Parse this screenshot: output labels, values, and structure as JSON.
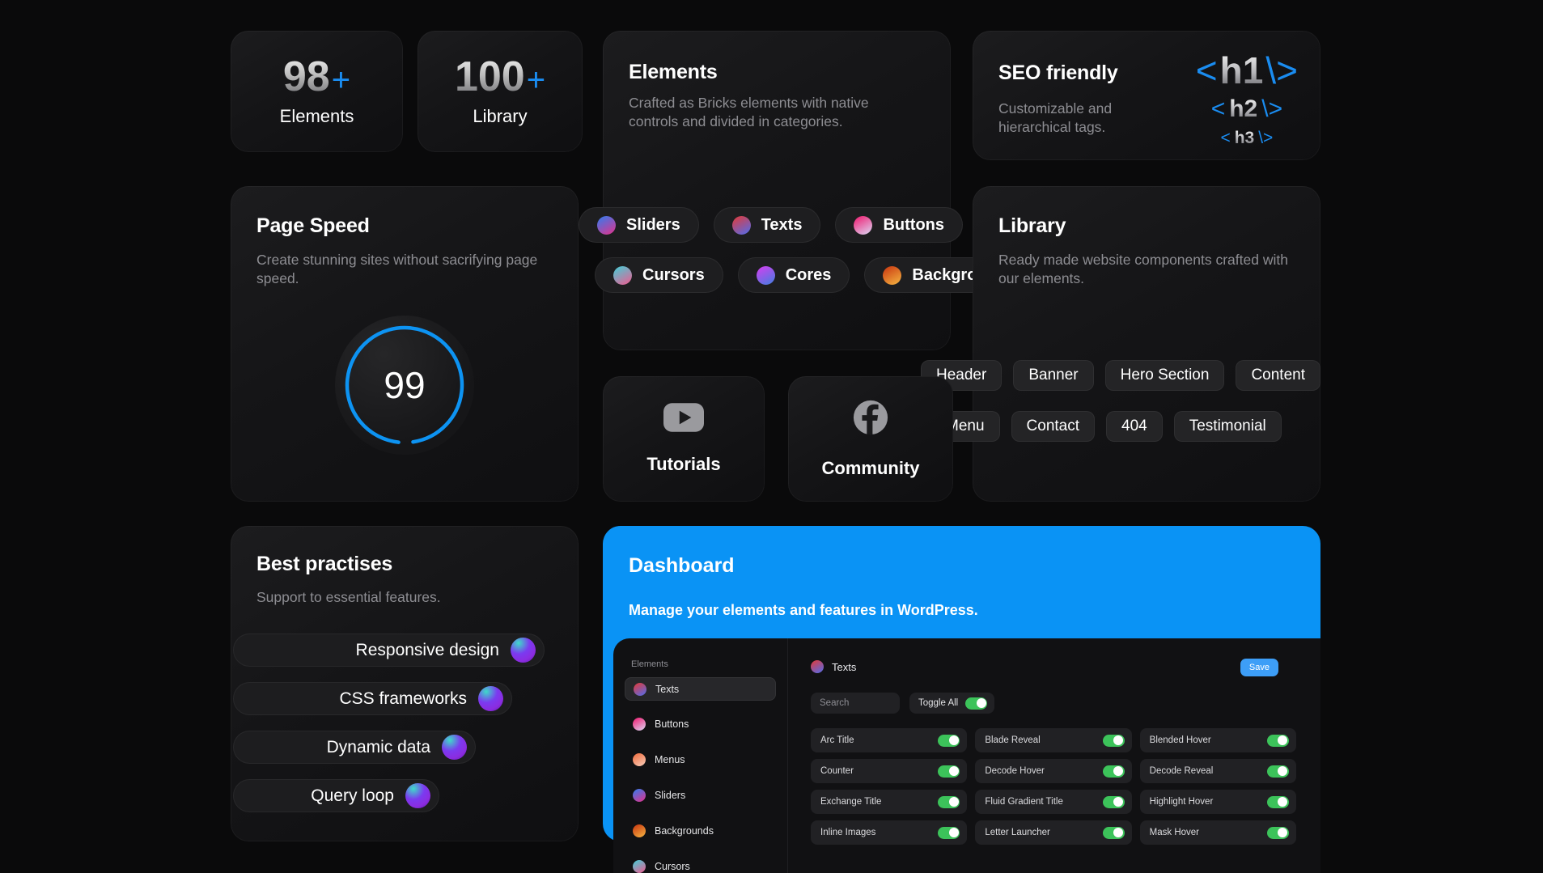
{
  "stats": [
    {
      "number": "98",
      "plus": "+",
      "label": "Elements"
    },
    {
      "number": "100",
      "plus": "+",
      "label": "Library"
    }
  ],
  "elements_card": {
    "title": "Elements",
    "subtitle": "Crafted as Bricks elements with native controls and divided in categories.",
    "pills_row1": [
      {
        "label": "Sliders",
        "color_a": "#2f7df0",
        "color_b": "#e5318a"
      },
      {
        "label": "Texts",
        "color_a": "#e53935",
        "color_b": "#4f6df0"
      },
      {
        "label": "Buttons",
        "color_a": "#f0176e",
        "color_b": "#dcd8f5"
      }
    ],
    "pills_row2": [
      {
        "label": "Cursors",
        "color_a": "#3fd0d8",
        "color_b": "#f25a8f"
      },
      {
        "label": "Cores",
        "color_a": "#d83df0",
        "color_b": "#3f7fe0"
      },
      {
        "label": "Backgrounds",
        "color_a": "#c8340f",
        "color_b": "#f5b642"
      }
    ]
  },
  "seo_card": {
    "title": "SEO friendly",
    "subtitle": "Customizable and hierarchical tags.",
    "h1_open": "<",
    "h1_tag": "h1",
    "h1_close": "\\>",
    "h2_open": "<",
    "h2_tag": "h2",
    "h2_close": "\\>",
    "h3_open": "<",
    "h3_tag": "h3",
    "h3_close": "\\>"
  },
  "page_speed_card": {
    "title": "Page Speed",
    "subtitle": "Create stunning sites without sacrifying page speed.",
    "score": "99",
    "ring_color": "#0d93f2"
  },
  "library_card": {
    "title": "Library",
    "subtitle": "Ready made website components crafted with our elements.",
    "tags_row1": [
      "Header",
      "Banner",
      "Hero Section",
      "Content"
    ],
    "tags_row2": [
      "Menu",
      "Contact",
      "404",
      "Testimonial"
    ]
  },
  "social_cards": [
    {
      "label": "Tutorials",
      "icon": "youtube-icon"
    },
    {
      "label": "Community",
      "icon": "facebook-icon"
    }
  ],
  "best_practises_card": {
    "title": "Best practises",
    "subtitle": "Support to essential features.",
    "rows": [
      "Responsive design",
      "CSS frameworks",
      "Dynamic data",
      "Query loop"
    ]
  },
  "dashboard_card": {
    "title": "Dashboard",
    "subtitle": "Manage your elements and features in WordPress.",
    "accent_color": "#0a93f5",
    "panel": {
      "sidebar_header": "Elements",
      "sidebar_items": [
        {
          "label": "Texts",
          "active": true,
          "color_a": "#e53935",
          "color_b": "#4f6df0"
        },
        {
          "label": "Buttons",
          "active": false,
          "color_a": "#f0176e",
          "color_b": "#dcd8f5"
        },
        {
          "label": "Menus",
          "active": false,
          "color_a": "#f06a3a",
          "color_b": "#f7cdbb"
        },
        {
          "label": "Sliders",
          "active": false,
          "color_a": "#2f7df0",
          "color_b": "#e5318a"
        },
        {
          "label": "Backgrounds",
          "active": false,
          "color_a": "#c8340f",
          "color_b": "#f5b642"
        },
        {
          "label": "Cursors",
          "active": false,
          "color_a": "#3fd0d8",
          "color_b": "#f25a8f"
        }
      ],
      "header_label": "Texts",
      "header_color_a": "#e53935",
      "header_color_b": "#4f6df0",
      "save_label": "Save",
      "search_placeholder": "Search",
      "toggle_all_label": "Toggle All",
      "toggle_all_on": true,
      "toggles": [
        {
          "label": "Arc Title",
          "on": true
        },
        {
          "label": "Blade Reveal",
          "on": true
        },
        {
          "label": "Blended Hover",
          "on": true
        },
        {
          "label": "Counter",
          "on": true
        },
        {
          "label": "Decode Hover",
          "on": true
        },
        {
          "label": "Decode Reveal",
          "on": true
        },
        {
          "label": "Exchange Title",
          "on": true
        },
        {
          "label": "Fluid Gradient Title",
          "on": true
        },
        {
          "label": "Highlight Hover",
          "on": true
        },
        {
          "label": "Inline Images",
          "on": true
        },
        {
          "label": "Letter Launcher",
          "on": true
        },
        {
          "label": "Mask Hover",
          "on": true
        }
      ]
    }
  }
}
